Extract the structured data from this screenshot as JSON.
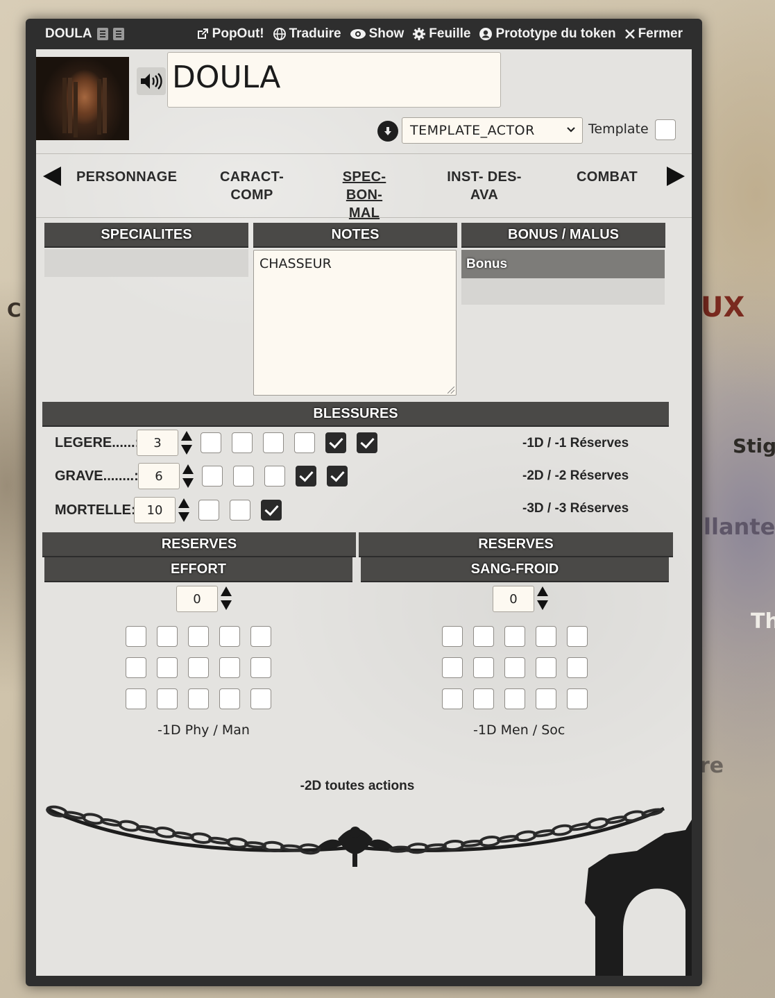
{
  "map_background": {
    "labels": [
      "C",
      "UX",
      "Stign",
      "llante",
      "Th",
      "re"
    ]
  },
  "window": {
    "title": "DOULA",
    "buttons": [
      {
        "icon": "external-link-icon",
        "label": "PopOut!"
      },
      {
        "icon": "globe-icon",
        "label": "Traduire"
      },
      {
        "icon": "eye-icon",
        "label": "Show"
      },
      {
        "icon": "gear-icon",
        "label": "Feuille"
      },
      {
        "icon": "user-circle-icon",
        "label": "Prototype du token"
      },
      {
        "icon": "close-icon",
        "label": "Fermer"
      }
    ]
  },
  "actor": {
    "name": "DOULA",
    "template_value": "TEMPLATE_ACTOR",
    "template_label": "Template",
    "template_checked": false
  },
  "tabs": [
    {
      "label": "PERSONNAGE",
      "active": false
    },
    {
      "label": "CARACT-\nCOMP",
      "active": false
    },
    {
      "label": "SPEC-BON-\nMAL",
      "active": true
    },
    {
      "label": "INST- DES-\nAVA",
      "active": false
    },
    {
      "label": "COMBAT",
      "active": false
    }
  ],
  "sections": {
    "specialites": "SPECIALITES",
    "notes": "NOTES",
    "bonus_malus": "BONUS / MALUS",
    "bonus_row": "Bonus",
    "notes_text": "CHASSEUR"
  },
  "wounds": {
    "header": "BLESSURES",
    "rows": [
      {
        "label": "LEGERE......:",
        "value": "3",
        "boxes": [
          false,
          false,
          false,
          false,
          true,
          true
        ],
        "penalty": "-1D / -1 Réserves"
      },
      {
        "label": "GRAVE........:",
        "value": "6",
        "boxes": [
          false,
          false,
          false,
          true,
          true
        ],
        "penalty": "-2D / -2 Réserves"
      },
      {
        "label": "MORTELLE:",
        "value": "10",
        "boxes": [
          false,
          false,
          true
        ],
        "penalty": "-3D / -3 Réserves"
      }
    ]
  },
  "reserves": [
    {
      "header": "RESERVES",
      "sub": "EFFORT",
      "value": "0",
      "grid_rows": 3,
      "grid_cols": 5,
      "penalty": "-1D Phy / Man"
    },
    {
      "header": "RESERVES",
      "sub": "SANG-FROID",
      "value": "0",
      "grid_rows": 3,
      "grid_cols": 5,
      "penalty": "-1D Men / Soc"
    }
  ],
  "all_actions_note": "-2D toutes actions",
  "colors": {
    "window_chrome": "#2e2e2e",
    "section_header": "#4a4947",
    "sheet_bg": "#e4e3e0",
    "input_bg": "#fdf9f1"
  }
}
